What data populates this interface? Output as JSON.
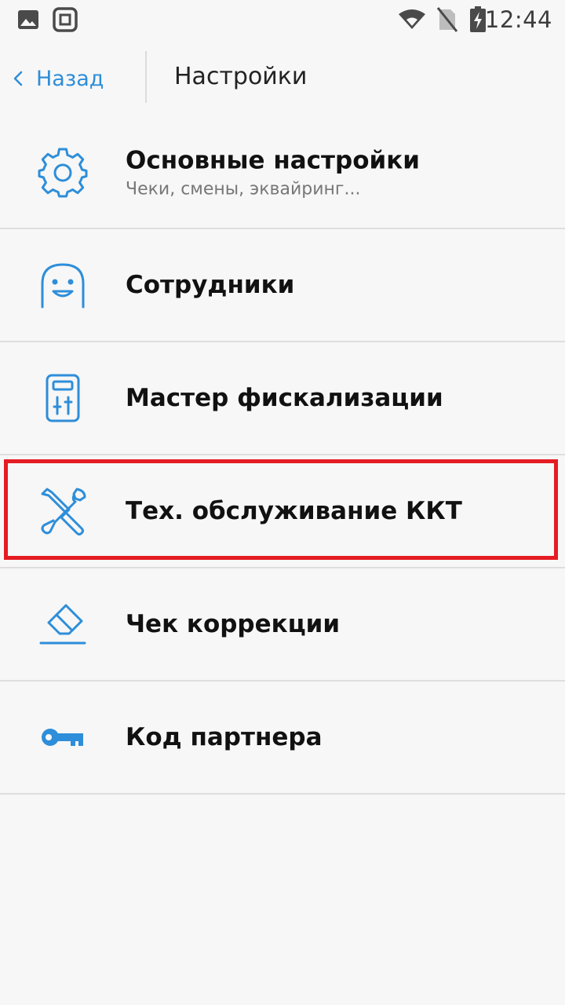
{
  "status_bar": {
    "time": "12:44",
    "icons": [
      "image-icon",
      "screenshot-icon",
      "wifi-icon",
      "no-sim-icon",
      "battery-charging-icon"
    ]
  },
  "header": {
    "back_label": "Назад",
    "title": "Настройки"
  },
  "menu": {
    "items": [
      {
        "label": "Основные настройки",
        "subtitle": "Чеки, смены, эквайринг...",
        "icon": "gear-icon"
      },
      {
        "label": "Сотрудники",
        "icon": "user-face-icon"
      },
      {
        "label": "Мастер фискализации",
        "icon": "fiscal-device-icon"
      },
      {
        "label": "Тех. обслуживание ККТ",
        "icon": "tools-icon",
        "highlighted": true
      },
      {
        "label": "Чек коррекции",
        "icon": "eraser-icon"
      },
      {
        "label": "Код партнера",
        "icon": "key-icon"
      }
    ]
  },
  "colors": {
    "accent": "#2e8ed9",
    "highlight": "#e51b23",
    "background": "#f7f7f7"
  }
}
